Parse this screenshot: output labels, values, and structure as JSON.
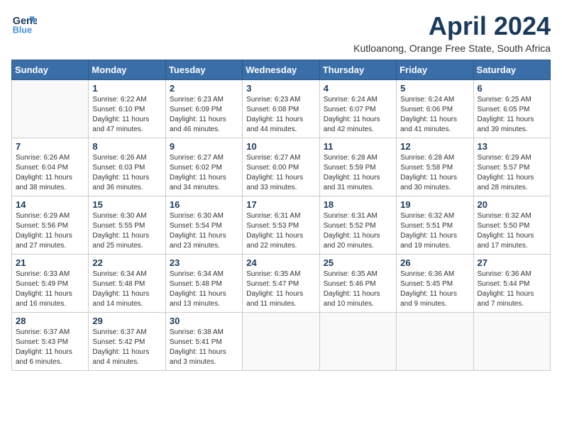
{
  "header": {
    "logo_line1": "General",
    "logo_line2": "Blue",
    "month_title": "April 2024",
    "subtitle": "Kutloanong, Orange Free State, South Africa"
  },
  "weekdays": [
    "Sunday",
    "Monday",
    "Tuesday",
    "Wednesday",
    "Thursday",
    "Friday",
    "Saturday"
  ],
  "weeks": [
    [
      {
        "day": "",
        "sunrise": "",
        "sunset": "",
        "daylight": ""
      },
      {
        "day": "1",
        "sunrise": "Sunrise: 6:22 AM",
        "sunset": "Sunset: 6:10 PM",
        "daylight": "Daylight: 11 hours and 47 minutes."
      },
      {
        "day": "2",
        "sunrise": "Sunrise: 6:23 AM",
        "sunset": "Sunset: 6:09 PM",
        "daylight": "Daylight: 11 hours and 46 minutes."
      },
      {
        "day": "3",
        "sunrise": "Sunrise: 6:23 AM",
        "sunset": "Sunset: 6:08 PM",
        "daylight": "Daylight: 11 hours and 44 minutes."
      },
      {
        "day": "4",
        "sunrise": "Sunrise: 6:24 AM",
        "sunset": "Sunset: 6:07 PM",
        "daylight": "Daylight: 11 hours and 42 minutes."
      },
      {
        "day": "5",
        "sunrise": "Sunrise: 6:24 AM",
        "sunset": "Sunset: 6:06 PM",
        "daylight": "Daylight: 11 hours and 41 minutes."
      },
      {
        "day": "6",
        "sunrise": "Sunrise: 6:25 AM",
        "sunset": "Sunset: 6:05 PM",
        "daylight": "Daylight: 11 hours and 39 minutes."
      }
    ],
    [
      {
        "day": "7",
        "sunrise": "Sunrise: 6:26 AM",
        "sunset": "Sunset: 6:04 PM",
        "daylight": "Daylight: 11 hours and 38 minutes."
      },
      {
        "day": "8",
        "sunrise": "Sunrise: 6:26 AM",
        "sunset": "Sunset: 6:03 PM",
        "daylight": "Daylight: 11 hours and 36 minutes."
      },
      {
        "day": "9",
        "sunrise": "Sunrise: 6:27 AM",
        "sunset": "Sunset: 6:02 PM",
        "daylight": "Daylight: 11 hours and 34 minutes."
      },
      {
        "day": "10",
        "sunrise": "Sunrise: 6:27 AM",
        "sunset": "Sunset: 6:00 PM",
        "daylight": "Daylight: 11 hours and 33 minutes."
      },
      {
        "day": "11",
        "sunrise": "Sunrise: 6:28 AM",
        "sunset": "Sunset: 5:59 PM",
        "daylight": "Daylight: 11 hours and 31 minutes."
      },
      {
        "day": "12",
        "sunrise": "Sunrise: 6:28 AM",
        "sunset": "Sunset: 5:58 PM",
        "daylight": "Daylight: 11 hours and 30 minutes."
      },
      {
        "day": "13",
        "sunrise": "Sunrise: 6:29 AM",
        "sunset": "Sunset: 5:57 PM",
        "daylight": "Daylight: 11 hours and 28 minutes."
      }
    ],
    [
      {
        "day": "14",
        "sunrise": "Sunrise: 6:29 AM",
        "sunset": "Sunset: 5:56 PM",
        "daylight": "Daylight: 11 hours and 27 minutes."
      },
      {
        "day": "15",
        "sunrise": "Sunrise: 6:30 AM",
        "sunset": "Sunset: 5:55 PM",
        "daylight": "Daylight: 11 hours and 25 minutes."
      },
      {
        "day": "16",
        "sunrise": "Sunrise: 6:30 AM",
        "sunset": "Sunset: 5:54 PM",
        "daylight": "Daylight: 11 hours and 23 minutes."
      },
      {
        "day": "17",
        "sunrise": "Sunrise: 6:31 AM",
        "sunset": "Sunset: 5:53 PM",
        "daylight": "Daylight: 11 hours and 22 minutes."
      },
      {
        "day": "18",
        "sunrise": "Sunrise: 6:31 AM",
        "sunset": "Sunset: 5:52 PM",
        "daylight": "Daylight: 11 hours and 20 minutes."
      },
      {
        "day": "19",
        "sunrise": "Sunrise: 6:32 AM",
        "sunset": "Sunset: 5:51 PM",
        "daylight": "Daylight: 11 hours and 19 minutes."
      },
      {
        "day": "20",
        "sunrise": "Sunrise: 6:32 AM",
        "sunset": "Sunset: 5:50 PM",
        "daylight": "Daylight: 11 hours and 17 minutes."
      }
    ],
    [
      {
        "day": "21",
        "sunrise": "Sunrise: 6:33 AM",
        "sunset": "Sunset: 5:49 PM",
        "daylight": "Daylight: 11 hours and 16 minutes."
      },
      {
        "day": "22",
        "sunrise": "Sunrise: 6:34 AM",
        "sunset": "Sunset: 5:48 PM",
        "daylight": "Daylight: 11 hours and 14 minutes."
      },
      {
        "day": "23",
        "sunrise": "Sunrise: 6:34 AM",
        "sunset": "Sunset: 5:48 PM",
        "daylight": "Daylight: 11 hours and 13 minutes."
      },
      {
        "day": "24",
        "sunrise": "Sunrise: 6:35 AM",
        "sunset": "Sunset: 5:47 PM",
        "daylight": "Daylight: 11 hours and 11 minutes."
      },
      {
        "day": "25",
        "sunrise": "Sunrise: 6:35 AM",
        "sunset": "Sunset: 5:46 PM",
        "daylight": "Daylight: 11 hours and 10 minutes."
      },
      {
        "day": "26",
        "sunrise": "Sunrise: 6:36 AM",
        "sunset": "Sunset: 5:45 PM",
        "daylight": "Daylight: 11 hours and 9 minutes."
      },
      {
        "day": "27",
        "sunrise": "Sunrise: 6:36 AM",
        "sunset": "Sunset: 5:44 PM",
        "daylight": "Daylight: 11 hours and 7 minutes."
      }
    ],
    [
      {
        "day": "28",
        "sunrise": "Sunrise: 6:37 AM",
        "sunset": "Sunset: 5:43 PM",
        "daylight": "Daylight: 11 hours and 6 minutes."
      },
      {
        "day": "29",
        "sunrise": "Sunrise: 6:37 AM",
        "sunset": "Sunset: 5:42 PM",
        "daylight": "Daylight: 11 hours and 4 minutes."
      },
      {
        "day": "30",
        "sunrise": "Sunrise: 6:38 AM",
        "sunset": "Sunset: 5:41 PM",
        "daylight": "Daylight: 11 hours and 3 minutes."
      },
      {
        "day": "",
        "sunrise": "",
        "sunset": "",
        "daylight": ""
      },
      {
        "day": "",
        "sunrise": "",
        "sunset": "",
        "daylight": ""
      },
      {
        "day": "",
        "sunrise": "",
        "sunset": "",
        "daylight": ""
      },
      {
        "day": "",
        "sunrise": "",
        "sunset": "",
        "daylight": ""
      }
    ]
  ]
}
